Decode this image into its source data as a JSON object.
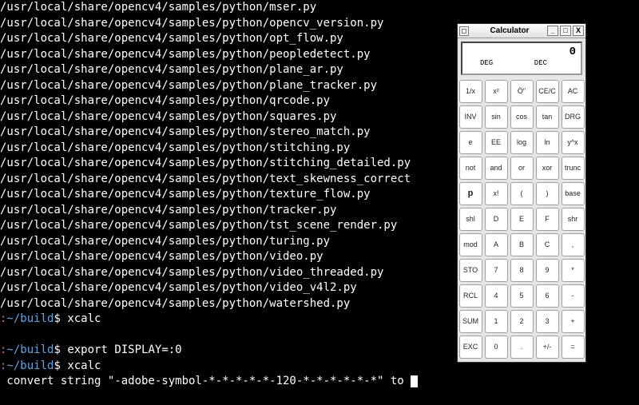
{
  "terminal": {
    "path_prefix": "/usr/local/share/opencv4/samples/python/",
    "files": [
      "mser.py",
      "opencv_version.py",
      "opt_flow.py",
      "peopledetect.py",
      "plane_ar.py",
      "plane_tracker.py",
      "qrcode.py",
      "squares.py",
      "stereo_match.py",
      "stitching.py",
      "stitching_detailed.py",
      "text_skewness_correct",
      "texture_flow.py",
      "tracker.py",
      "tst_scene_render.py",
      "turing.py",
      "video.py",
      "video_threaded.py",
      "video_v4l2.py",
      "watershed.py"
    ],
    "prompts": [
      {
        "host": ":",
        "path": "~/build",
        "dollar": "$",
        "cmd": " xcalc"
      },
      {
        "host": "",
        "path": "",
        "dollar": "",
        "cmd": ""
      },
      {
        "host": ":",
        "path": "~/build",
        "dollar": "$",
        "cmd": " export DISPLAY=:0"
      },
      {
        "host": ":",
        "path": "~/build",
        "dollar": "$",
        "cmd": " xcalc"
      }
    ],
    "warning": " convert string \"-adobe-symbol-*-*-*-*-*-120-*-*-*-*-*-*\" to "
  },
  "calculator": {
    "title": "Calculator",
    "window_controls": {
      "min": "_",
      "max": "□",
      "close": "X"
    },
    "display": {
      "value": "0",
      "mode1": "DEG",
      "mode2": "DEC"
    },
    "keys": [
      [
        "1/x",
        "x²",
        "Ö\"",
        "CE/C",
        "AC"
      ],
      [
        "INV",
        "sin",
        "cos",
        "tan",
        "DRG"
      ],
      [
        "e",
        "EE",
        "log",
        "ln",
        "y^x"
      ],
      [
        "not",
        "and",
        "or",
        "xor",
        "trunc"
      ],
      [
        "p",
        "x!",
        "(",
        ")",
        "base"
      ],
      [
        "shl",
        "D",
        "E",
        "F",
        "shr"
      ],
      [
        "mod",
        "A",
        "B",
        "C",
        ","
      ],
      [
        "STO",
        "7",
        "8",
        "9",
        "*"
      ],
      [
        "RCL",
        "4",
        "5",
        "6",
        "-"
      ],
      [
        "SUM",
        "1",
        "2",
        "3",
        "+"
      ],
      [
        "EXC",
        "0",
        ".",
        "+/-",
        "="
      ]
    ],
    "bold_keys": [
      "p"
    ]
  }
}
